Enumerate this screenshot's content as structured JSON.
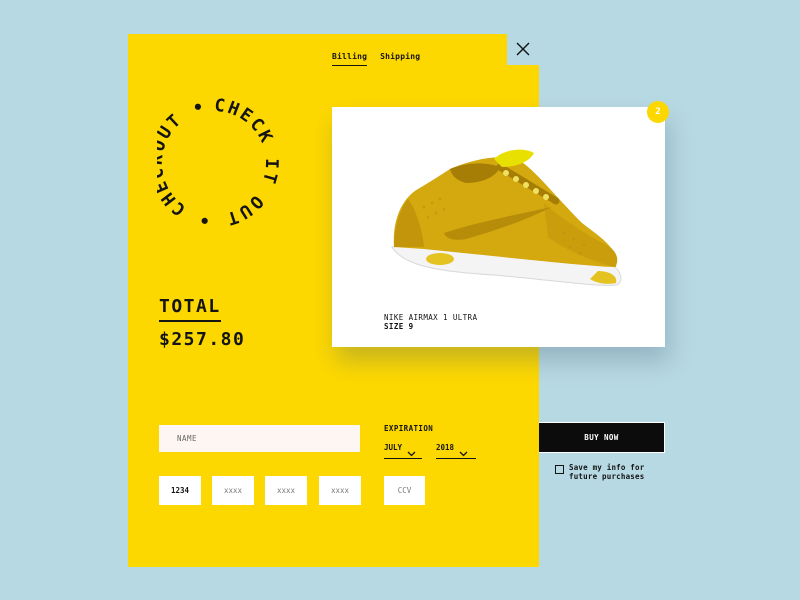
{
  "tabs": [
    "Billing",
    "Shipping"
  ],
  "badge": {
    "text": "CHECK IT OUT • CHECKOUT •"
  },
  "summary": {
    "total_label": "TOTAL",
    "total_value": "$257.80"
  },
  "product": {
    "name": "NIKE AIRMAX 1 ULTRA",
    "size": "SIZE 9",
    "quantity": "2",
    "image_icon": "sneaker-image"
  },
  "form": {
    "name_placeholder": "NAME",
    "expiration_label": "EXPIRATION",
    "month_value": "JULY",
    "year_value": "2018",
    "card_first": "1234",
    "card_placeholder": "xxxx",
    "ccv_placeholder": "CCV"
  },
  "actions": {
    "buy_label": "BUY NOW",
    "save_label": "Save my info for future purchases"
  },
  "colors": {
    "accent": "#fdd800",
    "background": "#b7d9e3",
    "dark": "#0c0c0c"
  }
}
